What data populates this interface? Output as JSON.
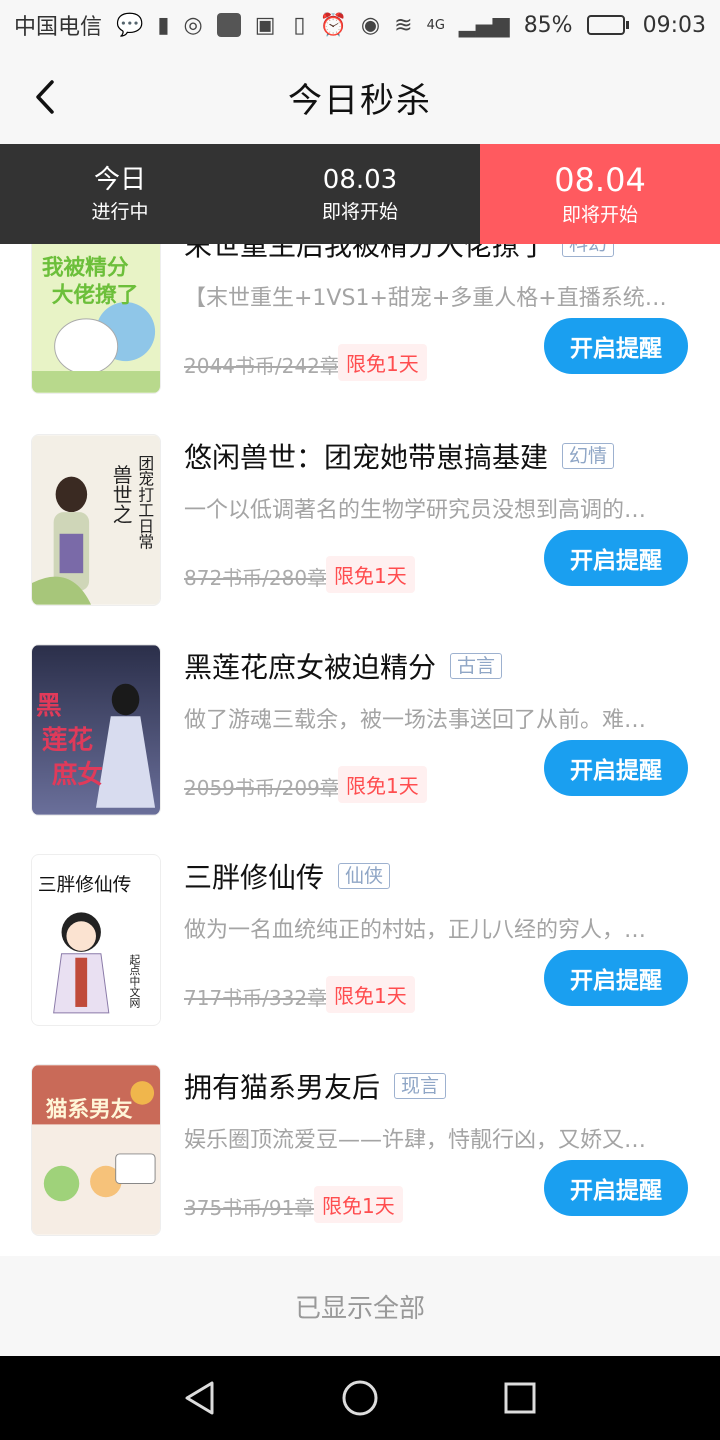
{
  "status_bar": {
    "carrier": "中国电信",
    "battery": "85%",
    "battery_level": 0.85,
    "network": "4G",
    "time": "09:03"
  },
  "header": {
    "title": "今日秒杀"
  },
  "tabs": [
    {
      "label": "今日",
      "sub": "进行中"
    },
    {
      "label": "08.03",
      "sub": "即将开始"
    },
    {
      "label": "08.04",
      "sub": "即将开始"
    }
  ],
  "colors": {
    "active_tab": "#ff5a5f",
    "tab_bar": "#333333",
    "button": "#1a9ff0",
    "free_tag": "#ff4d4f"
  },
  "books": [
    {
      "title": "末世重生后我被精分大佬撩了",
      "tag": "科幻",
      "desc": "【末世重生+1VS1+甜宠+多重人格+直播系统+…",
      "price": "2044书币/242章",
      "free": "限免1天",
      "button": "开启提醒"
    },
    {
      "title": "悠闲兽世：团宠她带崽搞基建",
      "tag": "幻情",
      "desc": "一个以低调著名的生物学研究员没想到高调的…",
      "price": "872书币/280章",
      "free": "限免1天",
      "button": "开启提醒",
      "cover_text": "兽世之团宠打工日常"
    },
    {
      "title": "黑莲花庶女被迫精分",
      "tag": "古言",
      "desc": "做了游魂三载余，被一场法事送回了从前。难…",
      "price": "2059书币/209章",
      "free": "限免1天",
      "button": "开启提醒",
      "cover_text": "黑莲花庶女"
    },
    {
      "title": "三胖修仙传",
      "tag": "仙侠",
      "desc": "做为一名血统纯正的村姑，正儿八经的穷人，…",
      "price": "717书币/332章",
      "free": "限免1天",
      "button": "开启提醒",
      "cover_text": "三胖修仙传"
    },
    {
      "title": "拥有猫系男友后",
      "tag": "现言",
      "desc": "娱乐圈顶流爱豆——许肆，恃靓行凶，又娇又…",
      "price": "375书币/91章",
      "free": "限免1天",
      "button": "开启提醒",
      "cover_text": "拥有猫系男友后"
    }
  ],
  "footer": {
    "text": "已显示全部"
  }
}
